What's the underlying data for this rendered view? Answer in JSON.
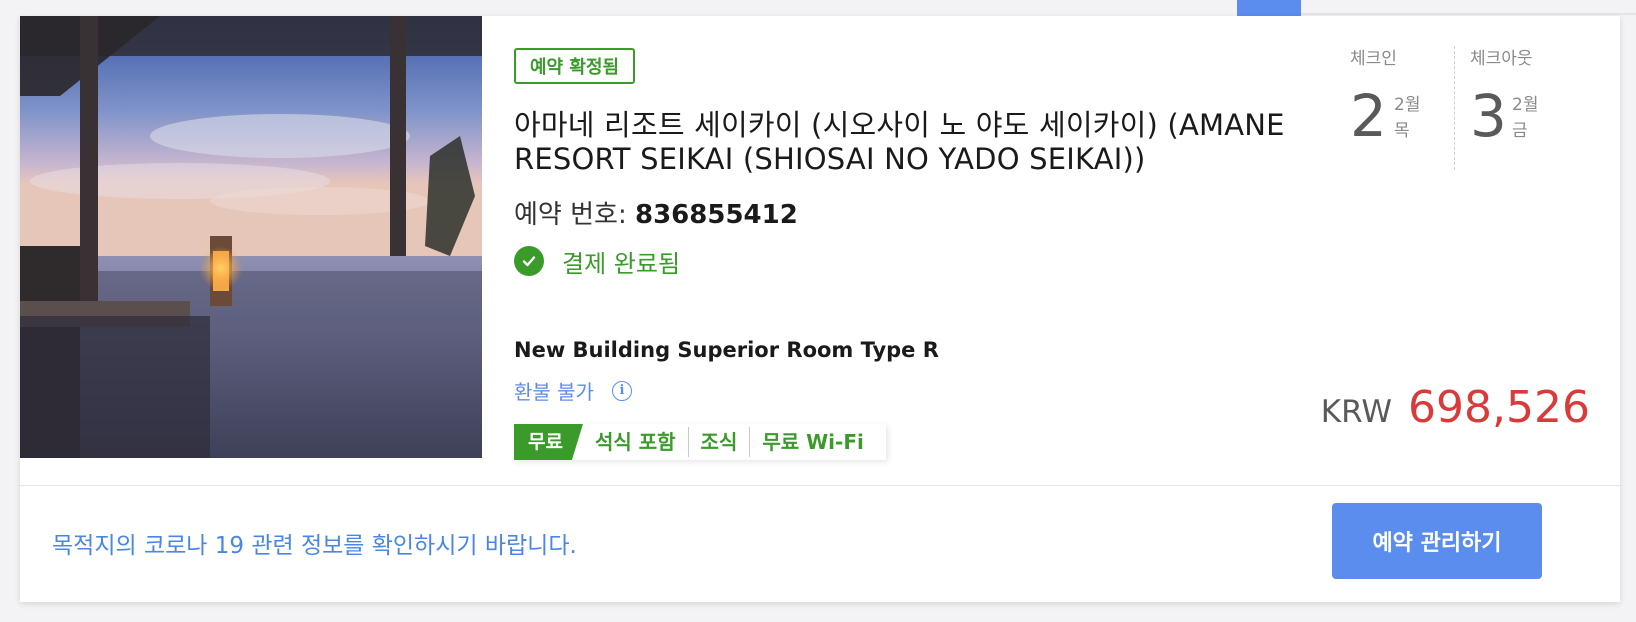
{
  "booking": {
    "status_badge": "예약 확정됨",
    "hotel_name": "아마네 리조트 세이카이 (시오사이 노 야도 세이카이) (AMANE RESORT SEIKAI (SHIOSAI NO YADO SEIKAI))",
    "booking_number_label": "예약 번호:",
    "booking_number": "836855412",
    "payment_status": "결제 완료됨",
    "room_type": "New Building Superior Room Type R",
    "refund_policy": "환불 불가",
    "info_icon_glyph": "i",
    "perks": {
      "free_tag": "무료",
      "items": [
        "석식 포함",
        "조식",
        "무료 Wi-Fi"
      ]
    }
  },
  "dates": {
    "checkin": {
      "label": "체크인",
      "day": "2",
      "month": "2월",
      "weekday": "목"
    },
    "checkout": {
      "label": "체크아웃",
      "day": "3",
      "month": "2월",
      "weekday": "금"
    }
  },
  "price": {
    "currency": "KRW",
    "amount": "698,526"
  },
  "footer": {
    "covid_notice": "목적지의 코로나 19 관련 정보를 확인하시기 바랍니다.",
    "manage_button": "예약 관리하기"
  },
  "colors": {
    "accent_blue": "#5b8def",
    "success_green": "#3a9b2b",
    "price_red": "#d93a3a"
  },
  "icons": {
    "payment": "check-circle-icon",
    "refund_info": "info-icon"
  }
}
